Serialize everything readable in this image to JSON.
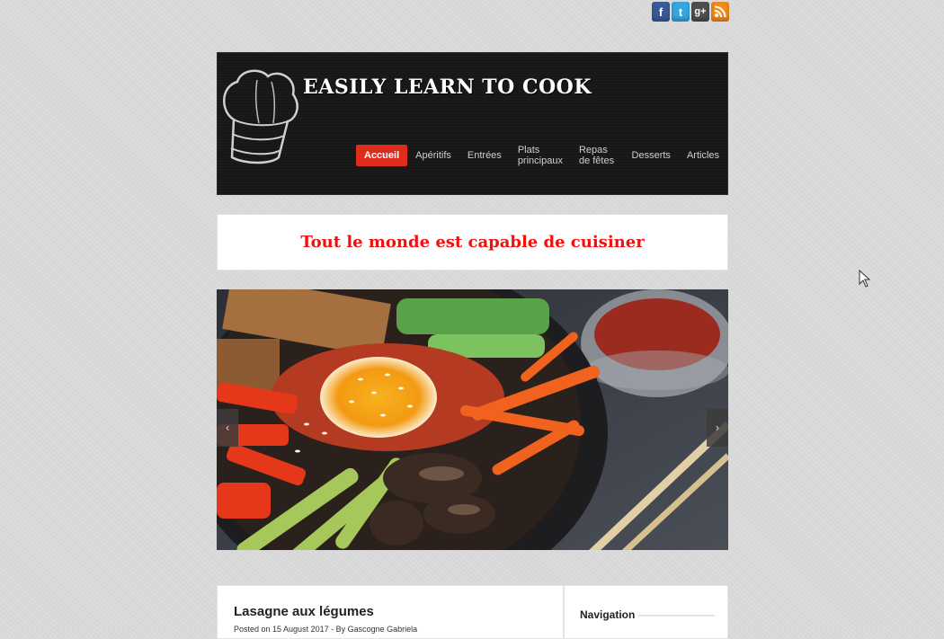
{
  "social": {
    "facebook": "f",
    "twitter": "t",
    "googleplus": "g+",
    "rss": "rss-icon"
  },
  "header": {
    "site_title": "EASILY LEARN TO COOK",
    "nav": [
      {
        "label": "Accueil",
        "active": true
      },
      {
        "label": "Apéritifs",
        "active": false
      },
      {
        "label": "Entrées",
        "active": false
      },
      {
        "label": "Plats principaux",
        "active": false
      },
      {
        "label": "Repas de fêtes",
        "active": false
      },
      {
        "label": "Desserts",
        "active": false
      },
      {
        "label": "Articles",
        "active": false
      }
    ]
  },
  "tagline": "Tout le monde est capable de cuisiner",
  "slider": {
    "prev": "‹",
    "next": "›"
  },
  "post": {
    "title": "Lasagne aux légumes",
    "meta": "Posted on 15 August 2017 - By Gascogne Gabriela"
  },
  "sidebar": {
    "title": "Navigation"
  },
  "colors": {
    "accent": "#e02c1c",
    "tagline": "#f01010",
    "header_bg": "#171717"
  }
}
